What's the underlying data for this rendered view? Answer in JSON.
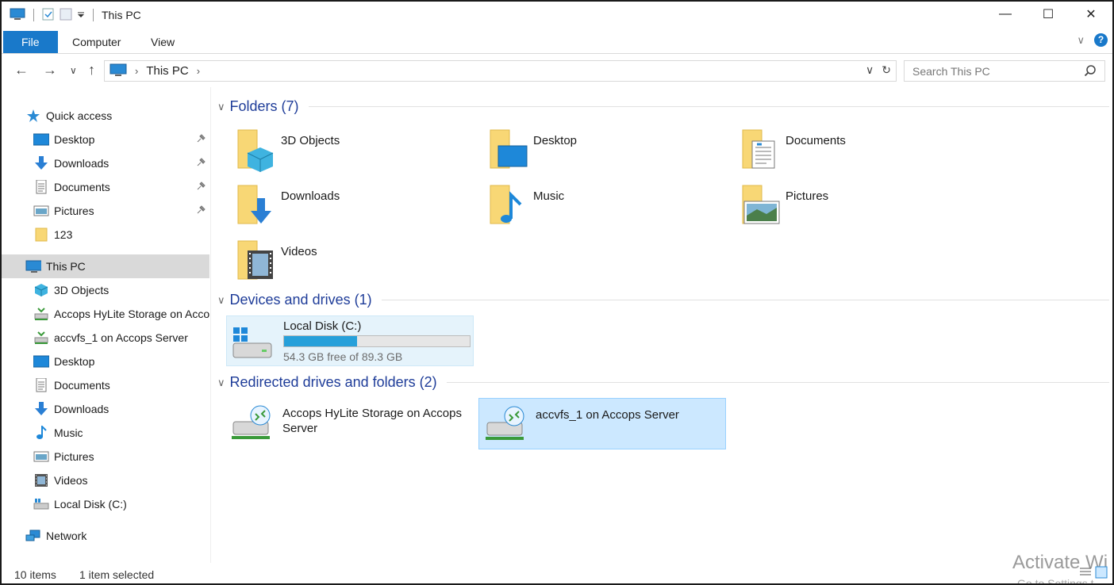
{
  "window": {
    "title": "This PC",
    "controls": {
      "minimize": "—",
      "maximize": "☐",
      "close": "✕"
    }
  },
  "ribbon": {
    "tabs": [
      "File",
      "Computer",
      "View"
    ],
    "expand_glyph": "∨",
    "help_glyph": "?"
  },
  "address": {
    "back": "←",
    "forward": "→",
    "recent": "∨",
    "up": "↑",
    "crumb": "This PC",
    "sep": "›",
    "dropdown": "∨",
    "refresh": "↻"
  },
  "search": {
    "placeholder": "Search This PC"
  },
  "sidebar": {
    "quick_access": {
      "label": "Quick access",
      "items": [
        {
          "label": "Desktop",
          "icon": "desktop-icon",
          "pinned": true
        },
        {
          "label": "Downloads",
          "icon": "downloads-icon",
          "pinned": true
        },
        {
          "label": "Documents",
          "icon": "documents-icon",
          "pinned": true
        },
        {
          "label": "Pictures",
          "icon": "pictures-icon",
          "pinned": true
        },
        {
          "label": "123",
          "icon": "folder-icon",
          "pinned": false
        }
      ]
    },
    "this_pc": {
      "label": "This PC",
      "items": [
        {
          "label": "3D Objects",
          "icon": "3d-objects-icon"
        },
        {
          "label": "Accops HyLite Storage on Accops Server",
          "icon": "network-drive-icon"
        },
        {
          "label": "accvfs_1 on Accops Server",
          "icon": "network-drive-icon"
        },
        {
          "label": "Desktop",
          "icon": "desktop-icon"
        },
        {
          "label": "Documents",
          "icon": "documents-icon"
        },
        {
          "label": "Downloads",
          "icon": "downloads-icon"
        },
        {
          "label": "Music",
          "icon": "music-icon"
        },
        {
          "label": "Pictures",
          "icon": "pictures-icon"
        },
        {
          "label": "Videos",
          "icon": "videos-icon"
        },
        {
          "label": "Local Disk (C:)",
          "icon": "local-disk-icon"
        }
      ]
    },
    "network": {
      "label": "Network"
    }
  },
  "content": {
    "folders_header": "Folders (7)",
    "folders": [
      {
        "label": "3D Objects",
        "icon": "3d-objects-icon"
      },
      {
        "label": "Desktop",
        "icon": "desktop-icon"
      },
      {
        "label": "Documents",
        "icon": "documents-icon"
      },
      {
        "label": "Downloads",
        "icon": "downloads-icon"
      },
      {
        "label": "Music",
        "icon": "music-icon"
      },
      {
        "label": "Pictures",
        "icon": "pictures-icon"
      },
      {
        "label": "Videos",
        "icon": "videos-icon"
      }
    ],
    "devices_header": "Devices and drives (1)",
    "drive": {
      "label": "Local Disk (C:)",
      "free_text": "54.3 GB free of 89.3 GB",
      "used_fraction": 0.392
    },
    "redirected_header": "Redirected drives and folders (2)",
    "redirected": [
      {
        "line1": "Accops HyLite Storage on Accops",
        "line2": "Server"
      },
      {
        "line1": "accvfs_1 on Accops Server",
        "line2": ""
      }
    ]
  },
  "status": {
    "items": "10 items",
    "selected": "1 item selected"
  },
  "watermark": {
    "line1": "Activate Wi",
    "line2": "Go to Settings t"
  },
  "colors": {
    "accent": "#1979ca",
    "header_text": "#1f3d99",
    "selection": "#cce8ff",
    "drive_fill": "#26a0da"
  }
}
